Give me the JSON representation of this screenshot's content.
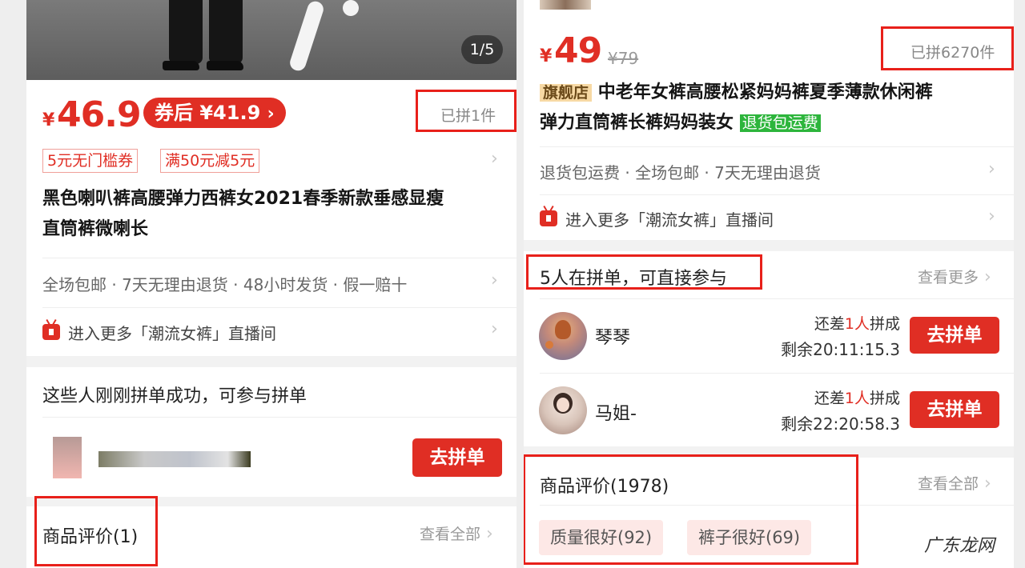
{
  "left": {
    "image_counter": "1/5",
    "price": {
      "symbol": "¥",
      "amount": "46.9",
      "coupon_label": "券后 ¥41.9"
    },
    "sold": "已拼1件",
    "tags": [
      "5元无门槛券",
      "满50元减5元"
    ],
    "title": [
      "黑色喇叭裤高腰弹力西裤女2021春季新款垂感显瘦",
      "直筒裤微喇长"
    ],
    "services": "全场包邮 · 7天无理由退货 · 48小时发货 · 假一赔十",
    "live_link": "进入更多「潮流女裤」直播间",
    "group_section": {
      "title": "这些人刚刚拼单成功，可参与拼单",
      "button": "去拼单"
    },
    "reviews": {
      "title": "商品评价(1)",
      "see_all": "查看全部"
    }
  },
  "right": {
    "price": {
      "symbol": "¥",
      "amount": "49",
      "original": "¥79"
    },
    "sold": "已拼6270件",
    "title": {
      "badge": "旗舰店",
      "line1": "中老年女裤高腰松紧妈妈裤夏季薄款休闲裤",
      "line2": "弹力直筒裤长裤妈妈装女",
      "tag": "退货包运费"
    },
    "services": "退货包运费 · 全场包邮 · 7天无理由退货",
    "live_link": "进入更多「潮流女裤」直播间",
    "group_section": {
      "title": "5人在拼单，可直接参与",
      "see_more": "查看更多",
      "entries": [
        {
          "name": "琴琴",
          "need_prefix": "还差",
          "need_count": "1人",
          "need_suffix": "拼成",
          "remaining": "剩余20:11:15.3",
          "button": "去拼单"
        },
        {
          "name": "马姐-",
          "need_prefix": "还差",
          "need_count": "1人",
          "need_suffix": "拼成",
          "remaining": "剩余22:20:58.3",
          "button": "去拼单"
        }
      ]
    },
    "reviews": {
      "title": "商品评价(1978)",
      "see_all": "查看全部",
      "chips": [
        "质量很好(92)",
        "裤子很好(69)"
      ]
    }
  },
  "watermark": "广东龙网",
  "colors": {
    "accent_red": "#e02e24",
    "annotation_red": "#e8201a",
    "green_tag": "#2db53c",
    "badge_bg": "#f7d9a4"
  }
}
